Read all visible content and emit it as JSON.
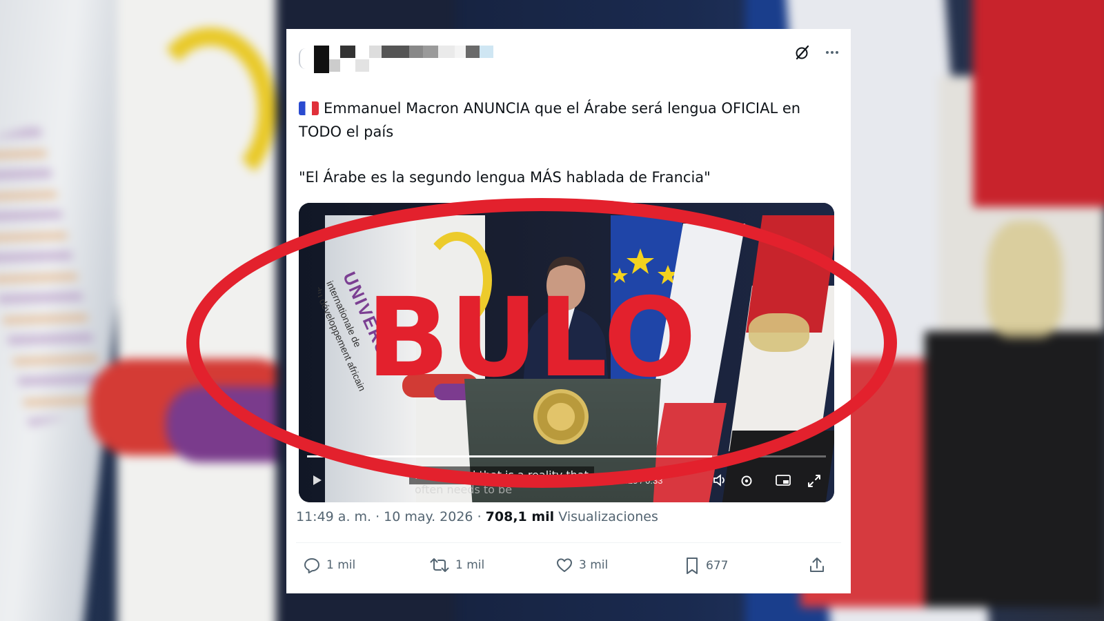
{
  "post": {
    "text_line1": "Emmanuel Macron ANUNCIA que el Árabe será lengua OFICIAL en TODO el país",
    "text_quote": "\"El Árabe es la segundo lengua MÁS hablada de Francia\"",
    "flag_emoji": "france-flag",
    "timestamp": "11:49 a. m. · 10 may. 2026",
    "separator": " · ",
    "views_count": "708,1 mil",
    "views_label": "Visualizaciones"
  },
  "video": {
    "subtitle_line1": "France and that is a reality that",
    "subtitle_line2": "often needs to be",
    "time_display": "0:25 / 0:33",
    "progress": 0.78
  },
  "stamp": {
    "label": "BULO",
    "color": "#e3212d"
  },
  "actions": {
    "replies": "1 mil",
    "reposts": "1 mil",
    "likes": "3 mil",
    "bookmarks": "677"
  },
  "icons": [
    "grok-icon",
    "more-icon",
    "reply-icon",
    "repost-icon",
    "like-icon",
    "bookmark-icon",
    "share-icon",
    "play-icon",
    "volume-icon",
    "settings-icon",
    "pip-icon",
    "fullscreen-icon"
  ]
}
